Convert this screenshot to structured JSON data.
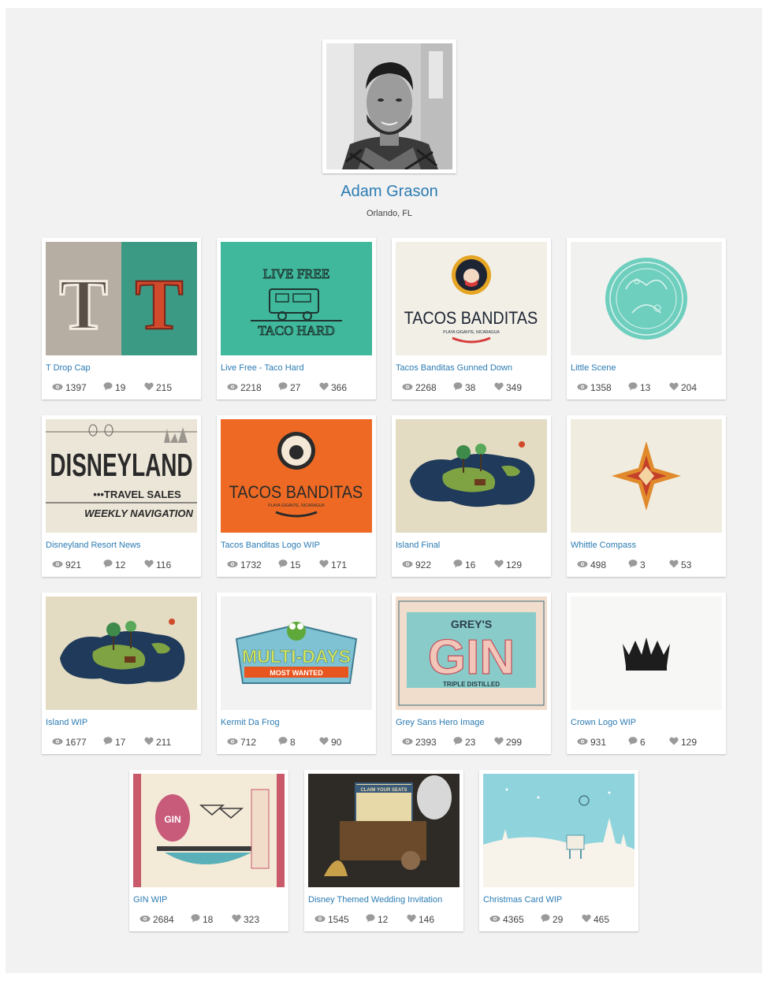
{
  "profile": {
    "name": "Adam Grason",
    "location": "Orlando, FL"
  },
  "projects": [
    {
      "title": "T Drop Cap",
      "views": "1397",
      "comments": "19",
      "likes": "215",
      "theme": "t-dropcap"
    },
    {
      "title": "Live Free - Taco Hard",
      "views": "2218",
      "comments": "27",
      "likes": "366",
      "theme": "taco-truck"
    },
    {
      "title": "Tacos Banditas Gunned Down",
      "views": "2268",
      "comments": "38",
      "likes": "349",
      "theme": "tacos-light"
    },
    {
      "title": "Little Scene",
      "views": "1358",
      "comments": "13",
      "likes": "204",
      "theme": "little-scene"
    },
    {
      "title": "Disneyland Resort News",
      "views": "921",
      "comments": "12",
      "likes": "116",
      "theme": "disneyland"
    },
    {
      "title": "Tacos Banditas Logo WIP",
      "views": "1732",
      "comments": "15",
      "likes": "171",
      "theme": "tacos-orange"
    },
    {
      "title": "Island Final",
      "views": "922",
      "comments": "16",
      "likes": "129",
      "theme": "island"
    },
    {
      "title": "Whittle Compass",
      "views": "498",
      "comments": "3",
      "likes": "53",
      "theme": "compass"
    },
    {
      "title": "Island WIP",
      "views": "1677",
      "comments": "17",
      "likes": "211",
      "theme": "island"
    },
    {
      "title": "Kermit Da Frog",
      "views": "712",
      "comments": "8",
      "likes": "90",
      "theme": "kermit"
    },
    {
      "title": "Grey Sans Hero Image",
      "views": "2393",
      "comments": "23",
      "likes": "299",
      "theme": "gin-label"
    },
    {
      "title": "Crown Logo WIP",
      "views": "931",
      "comments": "6",
      "likes": "129",
      "theme": "crown"
    },
    {
      "title": "GIN WIP",
      "views": "2684",
      "comments": "18",
      "likes": "323",
      "theme": "gin-wip"
    },
    {
      "title": "Disney Themed Wedding Invitation",
      "views": "1545",
      "comments": "12",
      "likes": "146",
      "theme": "wedding"
    },
    {
      "title": "Christmas Card WIP",
      "views": "4365",
      "comments": "29",
      "likes": "465",
      "theme": "christmas"
    }
  ],
  "artwork_text": {
    "live_free": "LIVE FREE",
    "taco_hard": "TACO HARD",
    "tacos_banditas": "TACOS BANDITAS",
    "playa": "PLAYA GIGANTE, NICARAGUA",
    "disneyland": "DISNEYLAND",
    "travel_sales": "•••TRAVEL SALES",
    "weekly_nav": "WEEKLY NAVIGATION",
    "multi_days": "MULTI-DAYS",
    "most_wanted": "MOST WANTED",
    "greys": "GREY'S",
    "gin": "GIN",
    "triple_distilled": "TRIPLE DISTILLED",
    "claim_seats": "CLAIM YOUR SEATS"
  },
  "icons": {
    "views": "eye-icon",
    "comments": "comment-icon",
    "likes": "heart-icon"
  },
  "colors": {
    "link": "#2b7bb3",
    "panel": "#f2f2f2",
    "icon": "#9a9a9a"
  }
}
